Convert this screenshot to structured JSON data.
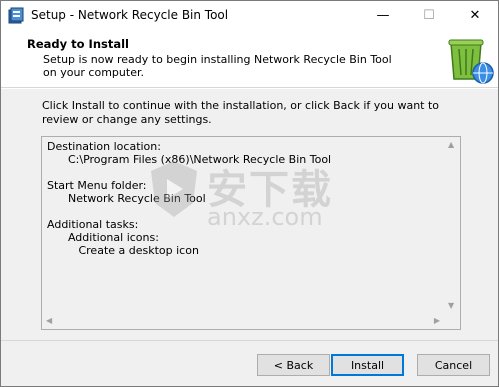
{
  "window": {
    "title": "Setup - Network Recycle Bin Tool",
    "minimize_glyph": "—",
    "maximize_glyph": "☐",
    "close_glyph": "✕"
  },
  "header": {
    "title": "Ready to Install",
    "subtitle": "Setup is now ready to begin installing Network Recycle Bin Tool on your computer.",
    "icon": "recycle-bin-icon"
  },
  "intro": "Click Install to continue with the installation, or click Back if you want to review or change any settings.",
  "summary": {
    "text": "Destination location:\n      C:\\Program Files (x86)\\Network Recycle Bin Tool\n\nStart Menu folder:\n      Network Recycle Bin Tool\n\nAdditional tasks:\n      Additional icons:\n         Create a desktop icon"
  },
  "watermark": {
    "cn": "安下载",
    "en": "anxz.com"
  },
  "buttons": {
    "back": "< Back",
    "install": "Install",
    "cancel": "Cancel"
  },
  "colors": {
    "accent": "#0078d7",
    "bg": "#f0f0f0"
  }
}
